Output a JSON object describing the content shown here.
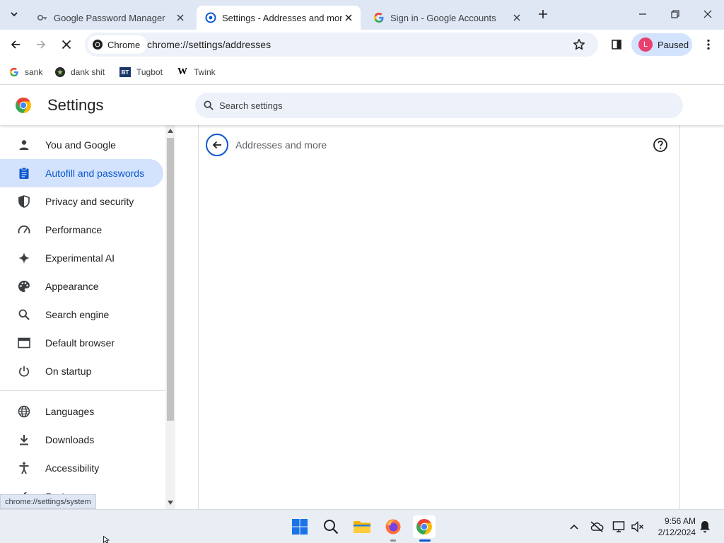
{
  "tabs": [
    {
      "title": "Google Password Manager",
      "active": false
    },
    {
      "title": "Settings - Addresses and more",
      "active": true
    },
    {
      "title": "Sign in - Google Accounts",
      "active": false
    }
  ],
  "toolbar": {
    "chip_label": "Chrome",
    "url": "chrome://settings/addresses",
    "profile_initial": "L",
    "profile_status": "Paused"
  },
  "bookmarks": [
    {
      "label": "sank",
      "icon": "google-icon"
    },
    {
      "label": "dank shit",
      "icon": "dank-icon"
    },
    {
      "label": "Tugbot",
      "icon": "bt-icon",
      "icon_text": "BT"
    },
    {
      "label": "Twink",
      "icon": "w-icon",
      "icon_text": "W"
    }
  ],
  "settings": {
    "title": "Settings",
    "search_placeholder": "Search settings"
  },
  "sidebar": {
    "items": [
      {
        "label": "You and Google",
        "icon": "person-icon"
      },
      {
        "label": "Autofill and passwords",
        "icon": "clipboard-icon",
        "selected": true
      },
      {
        "label": "Privacy and security",
        "icon": "shield-icon"
      },
      {
        "label": "Performance",
        "icon": "gauge-icon"
      },
      {
        "label": "Experimental AI",
        "icon": "sparkle-icon"
      },
      {
        "label": "Appearance",
        "icon": "palette-icon"
      },
      {
        "label": "Search engine",
        "icon": "search-icon"
      },
      {
        "label": "Default browser",
        "icon": "browser-icon"
      },
      {
        "label": "On startup",
        "icon": "power-icon"
      },
      {
        "label": "Languages",
        "icon": "globe-icon"
      },
      {
        "label": "Downloads",
        "icon": "download-icon"
      },
      {
        "label": "Accessibility",
        "icon": "accessibility-icon"
      },
      {
        "label": "System",
        "icon": "wrench-icon"
      }
    ]
  },
  "main": {
    "subtitle": "Addresses and more"
  },
  "status_url": "chrome://settings/system",
  "clock": {
    "time": "9:56 AM",
    "date": "2/12/2024"
  },
  "colors": {
    "accent": "#0b57d0",
    "selected_bg": "#d3e3fd",
    "tabstrip_bg": "#dfe6f4"
  }
}
